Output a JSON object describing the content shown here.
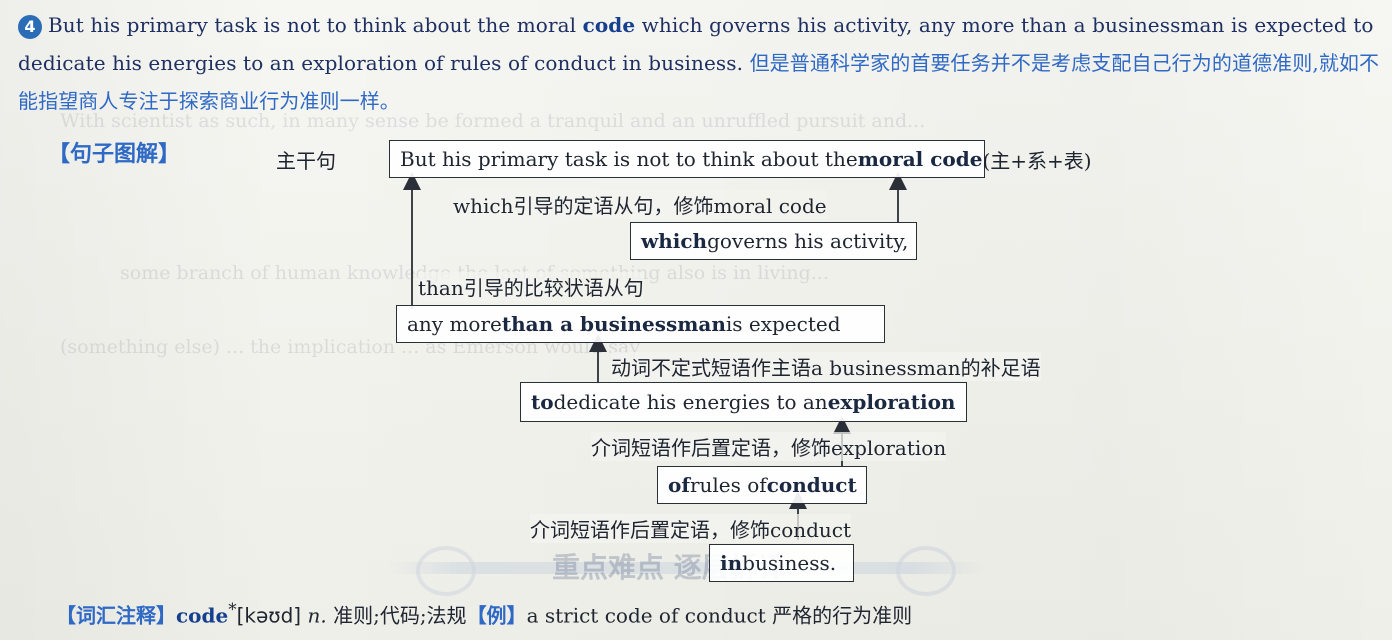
{
  "sentence": {
    "number": "4",
    "text_before_code": "But his primary task is not to think about the moral ",
    "code_word": "code",
    "text_after_code": " which governs his activity, any more than a businessman is expected to dedicate his energies to an exploration of rules of conduct in business. ",
    "translation": "但是普通科学家的首要任务并不是考虑支配自己行为的道德准则,就如不能指望商人专注于探索商业行为准则一样。"
  },
  "diagram": {
    "section_label": "【句子图解】",
    "main_clause_label": "主干句",
    "main_clause": {
      "prefix": "But his primary task is not to think about the ",
      "emphasis": "moral code",
      "suffix": " (主+系+表)"
    },
    "note_which": "which引导的定语从句，修饰moral code",
    "which_clause": {
      "emphasis": "which",
      "rest": " governs his activity,"
    },
    "note_than": "than引导的比较状语从句",
    "than_clause": {
      "prefix": "any more ",
      "emphasis": "than a businessman",
      "suffix": " is expected"
    },
    "note_infinitive": "动词不定式短语作主语a businessman的补足语",
    "infinitive_clause": {
      "prefix_emphasis": "to",
      "middle": " dedicate his energies to an ",
      "suffix_emphasis": "exploration"
    },
    "note_prep1": "介词短语作后置定语，修饰exploration",
    "prep1_clause": {
      "prefix_emphasis": "of",
      "middle": " rules of ",
      "suffix_emphasis": "conduct"
    },
    "note_prep2": "介词短语作后置定语，修饰conduct",
    "prep2_clause": {
      "prefix_emphasis": "in",
      "rest": " business."
    }
  },
  "vocab": {
    "label": "【词汇注释】",
    "word": "code",
    "marker": "*",
    "phonetic": "[kəʊd]",
    "pos": "n.",
    "meaning": "准则;代码;法规",
    "example_label": "【例】",
    "example_en": "a strict code of conduct",
    "example_zh": "严格的行为准则"
  },
  "stamp_text": "重点难点 逐层拆译",
  "colors": {
    "accent": "#2f69c6",
    "accent_dark": "#163f8d",
    "text": "#1f2530",
    "paper": "#f3f3ef"
  }
}
